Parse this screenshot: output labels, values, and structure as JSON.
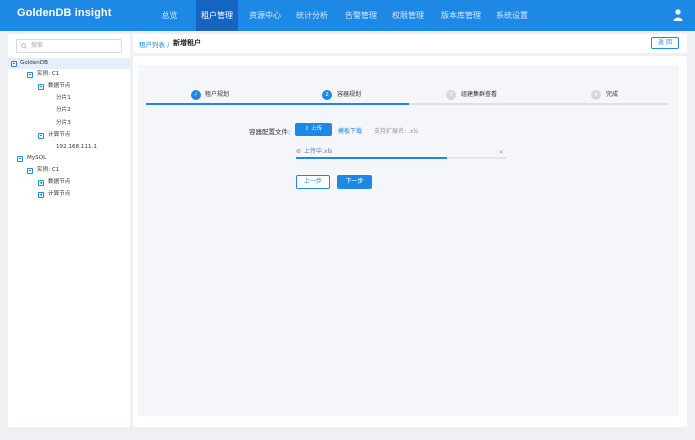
{
  "app": {
    "title": "GoldenDB insight",
    "accent": "#1e88e5"
  },
  "nav": {
    "items": [
      {
        "label": "总览"
      },
      {
        "label": "租户管理",
        "active": true
      },
      {
        "label": "资源中心"
      },
      {
        "label": "统计分析"
      },
      {
        "label": "告警管理"
      },
      {
        "label": "权限管理"
      },
      {
        "label": "版本库管理"
      },
      {
        "label": "系统设置"
      }
    ],
    "user_icon": "user-icon"
  },
  "sidebar": {
    "search_placeholder": "搜索",
    "tree": [
      {
        "label": "GoldenDB",
        "selected": true
      },
      {
        "label": "实例: C1"
      },
      {
        "label": "数据节点"
      },
      {
        "label": "分片1"
      },
      {
        "label": "分片2"
      },
      {
        "label": "分片3"
      },
      {
        "label": "计算节点"
      },
      {
        "label": "192.168.111.1"
      },
      {
        "label": "MySQL"
      },
      {
        "label": "实例: C1"
      },
      {
        "label": "数据节点"
      },
      {
        "label": "计算节点"
      }
    ]
  },
  "header": {
    "breadcrumb_link": "租户列表 /",
    "breadcrumb_current": "新增租户",
    "back_label": "返 回"
  },
  "steps": [
    {
      "label": "租户规划",
      "status": "done",
      "mark": "✓"
    },
    {
      "label": "容器规划",
      "status": "active",
      "mark": "2"
    },
    {
      "label": "组建集群查看",
      "status": "pending",
      "mark": "3"
    },
    {
      "label": "完成",
      "status": "pending",
      "mark": "4"
    }
  ],
  "form": {
    "label": "容器配置文件:",
    "upload_label": "上传",
    "template_link": "模板下载",
    "ext_hint": "支持扩展名: .xls",
    "file_name": "上传中.xls",
    "upload_progress_pct": 72,
    "prev_label": "上一步",
    "next_label": "下一步"
  }
}
